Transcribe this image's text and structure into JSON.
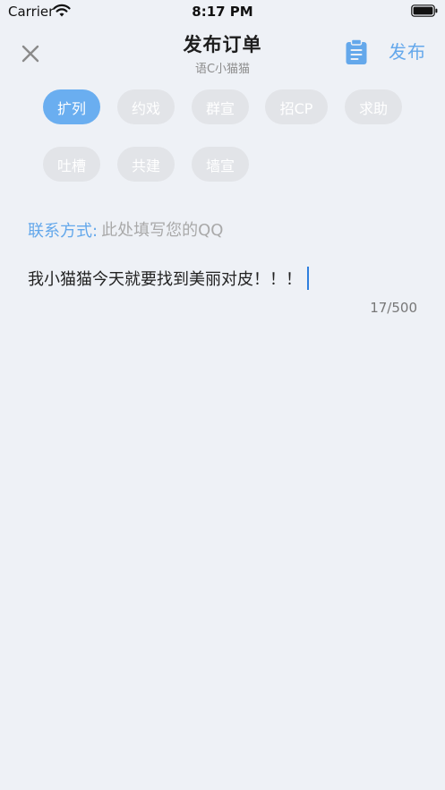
{
  "status_bar": {
    "carrier": "Carrier",
    "time": "8:17 PM"
  },
  "nav": {
    "title": "发布订单",
    "subtitle": "语C小猫猫",
    "publish_label": "发布"
  },
  "tags": [
    {
      "label": "扩列",
      "selected": true
    },
    {
      "label": "约戏",
      "selected": false
    },
    {
      "label": "群宣",
      "selected": false
    },
    {
      "label": "招CP",
      "selected": false
    },
    {
      "label": "求助",
      "selected": false
    },
    {
      "label": "吐槽",
      "selected": false
    },
    {
      "label": "共建",
      "selected": false
    },
    {
      "label": "墙宣",
      "selected": false
    }
  ],
  "contact": {
    "label": "联系方式:",
    "placeholder": "此处填写您的QQ",
    "value": ""
  },
  "content": {
    "text": "我小猫猫今天就要找到美丽对皮！！！",
    "counter": "17/500"
  },
  "colors": {
    "accent": "#64a8eb",
    "tag_active": "#6aaef0",
    "tag_inactive": "#e2e4e8",
    "background": "#eef1f6",
    "cursor": "#2f7fde"
  },
  "icons": [
    "wifi-icon",
    "battery-icon",
    "close-icon",
    "clipboard-icon"
  ]
}
